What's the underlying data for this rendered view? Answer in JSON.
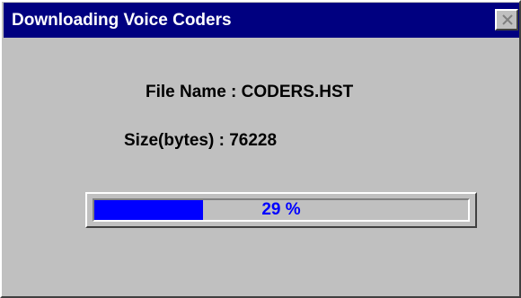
{
  "window": {
    "title": "Downloading Voice Coders"
  },
  "file": {
    "name_label": "File Name : ",
    "name_value": "CODERS.HST",
    "size_label": "Size(bytes) : ",
    "size_value": "76228"
  },
  "progress": {
    "percent": 29,
    "text": "29 %",
    "fill_color": "#0000ff"
  },
  "icons": {
    "close": "close-icon"
  }
}
